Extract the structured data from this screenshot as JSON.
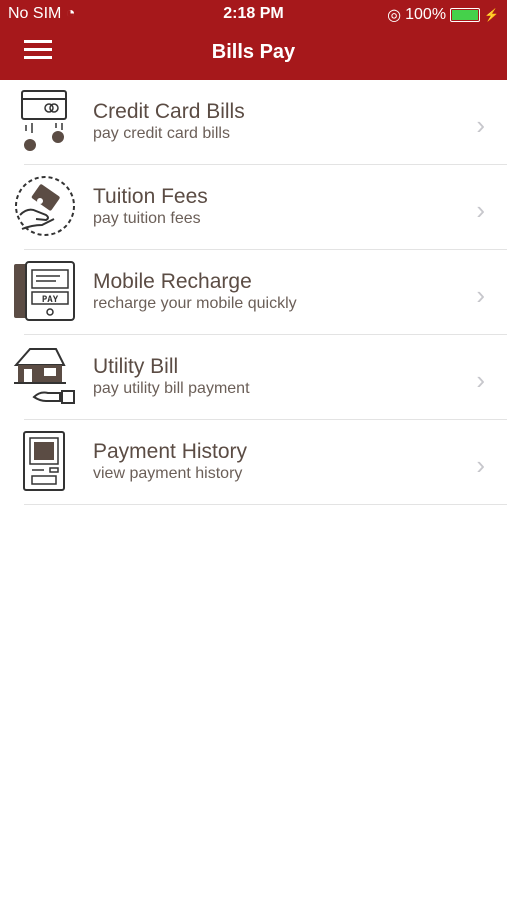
{
  "status_bar": {
    "carrier": "No SIM",
    "time": "2:18 PM",
    "battery": "100%"
  },
  "header": {
    "title": "Bills Pay"
  },
  "items": [
    {
      "title": "Credit Card Bills",
      "subtitle": "pay credit card bills"
    },
    {
      "title": "Tuition Fees",
      "subtitle": "pay tuition fees"
    },
    {
      "title": "Mobile Recharge",
      "subtitle": "recharge your mobile quickly"
    },
    {
      "title": "Utility Bill",
      "subtitle": "pay utility bill payment"
    },
    {
      "title": "Payment History",
      "subtitle": "view payment history"
    }
  ],
  "colors": {
    "brand": "#a6181b",
    "icon": "#5b4c44"
  }
}
